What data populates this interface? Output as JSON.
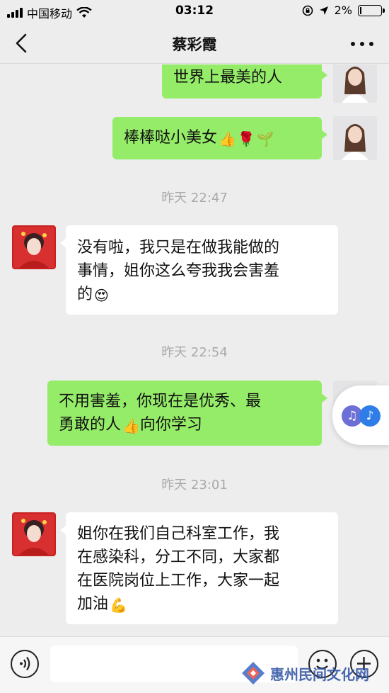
{
  "status_bar": {
    "carrier": "中国移动",
    "time": "03:12",
    "battery_text": "2%",
    "battery_level": 0.02
  },
  "nav": {
    "title": "蔡彩霞"
  },
  "messages": [
    {
      "side": "out",
      "text": "世界上最美的人"
    },
    {
      "side": "out",
      "text": "棒棒哒小美女",
      "emojis": [
        "👍",
        "🌹",
        "🌱"
      ]
    },
    {
      "type": "timestamp",
      "text": "昨天 22:47"
    },
    {
      "side": "in",
      "lines": [
        "没有啦，我只是在做我能做的",
        "事情，姐你这么夸我我会害羞",
        "的"
      ],
      "emojis": [
        "😍"
      ]
    },
    {
      "type": "timestamp",
      "text": "昨天 22:54"
    },
    {
      "side": "out",
      "lines": [
        "不用害羞，你现在是优秀、最",
        "勇敢的人",
        "向你学习"
      ],
      "emojis": [
        "👍"
      ]
    },
    {
      "type": "timestamp",
      "text": "昨天 23:01"
    },
    {
      "side": "in",
      "lines": [
        "姐你在我们自己科室工作，我",
        "在感染科，分工不同，大家都",
        "在医院岗位上工作，大家一起",
        "加油"
      ],
      "emojis": [
        "💪"
      ]
    }
  ],
  "input_bar": {
    "placeholder": ""
  },
  "watermark": {
    "text": "惠州民间文化网"
  },
  "icons": {
    "back": "chevron-left-icon",
    "more": "more-dots-icon",
    "voice": "voice-icon",
    "emoji": "emoji-face-icon",
    "plus": "plus-icon",
    "music": "music-note-icon"
  },
  "colors": {
    "outgoing_bubble": "#95ec69",
    "incoming_bubble": "#ffffff",
    "background": "#ededed"
  }
}
